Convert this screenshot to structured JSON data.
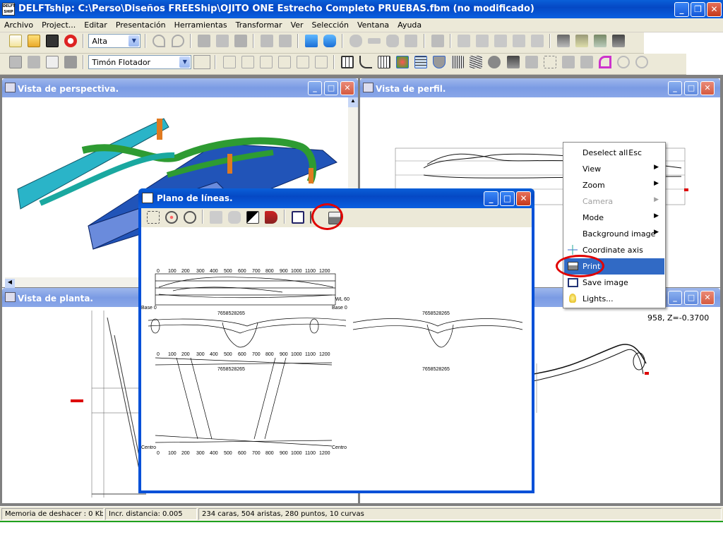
{
  "app": {
    "title": "DELFTship: C:\\Perso\\Diseños FREEShip\\OJITO ONE Estrecho Completo PRUEBAS.fbm (no modificado)",
    "icon": "delftship-logo-icon"
  },
  "menu": [
    "Archivo",
    "Project...",
    "Editar",
    "Presentación",
    "Herramientas",
    "Transformar",
    "Ver",
    "Selección",
    "Ventana",
    "Ayuda"
  ],
  "toolbar1": {
    "precision_combo": "Alta"
  },
  "toolbar2": {
    "layer_combo": "Timón Flotador"
  },
  "windows": {
    "perspective": {
      "title": "Vista de perspectiva."
    },
    "profile": {
      "title": "Vista de perfil."
    },
    "plan": {
      "title": "Vista de planta."
    },
    "lines_plan": {
      "title": "Plano de líneas."
    }
  },
  "lines_scale": [
    "0",
    "100",
    "200",
    "300",
    "400",
    "500",
    "600",
    "700",
    "800",
    "900",
    "1000",
    "1100",
    "1200"
  ],
  "lines_labels": {
    "base": "Base 0",
    "centro": "Centro",
    "wl": "WL 60",
    "section_id": "7658528265"
  },
  "context_menu": {
    "items": [
      {
        "label": "Deselect all",
        "shortcut": "Esc",
        "icon": ""
      },
      {
        "label": "View",
        "submenu": true,
        "icon": ""
      },
      {
        "label": "Zoom",
        "submenu": true,
        "icon": ""
      },
      {
        "label": "Camera",
        "submenu": true,
        "disabled": true,
        "icon": ""
      },
      {
        "label": "Mode",
        "submenu": true,
        "icon": ""
      },
      {
        "label": "Background image",
        "submenu": true,
        "icon": ""
      },
      {
        "label": "Coordinate axis",
        "icon": "coordinate-axis-icon"
      },
      {
        "label": "Print",
        "selected": true,
        "icon": "printer-icon"
      },
      {
        "label": "Save image",
        "icon": "save-image-icon"
      },
      {
        "label": "Lights...",
        "icon": "lightbulb-icon"
      }
    ]
  },
  "coord_readout": "958,   Z=-0.3700",
  "status": {
    "undo_memory": "Memoria de deshacer : 0 Kb.",
    "distance_inc": "Incr. distancia: 0.005",
    "counts": "234 caras, 504 aristas, 280 puntos, 10 curvas"
  },
  "colors": {
    "highlight_ring": "#e00000",
    "menu_selection": "#316ac5",
    "title_blue": "#0a5fd8"
  }
}
